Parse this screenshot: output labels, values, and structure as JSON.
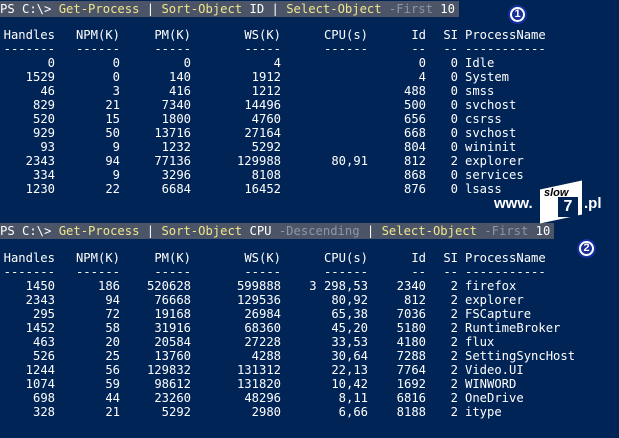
{
  "prompt": "PS C:\\> ",
  "commands": [
    {
      "marker": "1",
      "tokens": [
        {
          "t": "Get-Process",
          "c": "y"
        },
        {
          "t": " | ",
          "c": "w"
        },
        {
          "t": "Sort-Object",
          "c": "y"
        },
        {
          "t": " ID ",
          "c": "w"
        },
        {
          "t": "| ",
          "c": "w"
        },
        {
          "t": "Select-Object",
          "c": "y"
        },
        {
          "t": " -First ",
          "c": "g"
        },
        {
          "t": "10",
          "c": "w"
        }
      ],
      "rows": [
        [
          "0",
          "0",
          "0",
          "4",
          "",
          "0",
          "0",
          "Idle"
        ],
        [
          "1529",
          "0",
          "140",
          "1912",
          "",
          "4",
          "0",
          "System"
        ],
        [
          "46",
          "3",
          "416",
          "1212",
          "",
          "488",
          "0",
          "smss"
        ],
        [
          "829",
          "21",
          "7340",
          "14496",
          "",
          "500",
          "0",
          "svchost"
        ],
        [
          "520",
          "15",
          "1800",
          "4760",
          "",
          "656",
          "0",
          "csrss"
        ],
        [
          "929",
          "50",
          "13716",
          "27164",
          "",
          "668",
          "0",
          "svchost"
        ],
        [
          "93",
          "9",
          "1232",
          "5292",
          "",
          "804",
          "0",
          "wininit"
        ],
        [
          "2343",
          "94",
          "77136",
          "129988",
          "80,91",
          "812",
          "2",
          "explorer"
        ],
        [
          "334",
          "9",
          "3296",
          "8108",
          "",
          "868",
          "0",
          "services"
        ],
        [
          "1230",
          "22",
          "6684",
          "16452",
          "",
          "876",
          "0",
          "lsass"
        ]
      ]
    },
    {
      "marker": "2",
      "tokens": [
        {
          "t": "Get-Process",
          "c": "y"
        },
        {
          "t": " | ",
          "c": "w"
        },
        {
          "t": "Sort-Object",
          "c": "y"
        },
        {
          "t": " CPU ",
          "c": "w"
        },
        {
          "t": "-Descending",
          "c": "g"
        },
        {
          "t": " | ",
          "c": "w"
        },
        {
          "t": "Select-Object",
          "c": "y"
        },
        {
          "t": " -First ",
          "c": "g"
        },
        {
          "t": "10",
          "c": "w"
        }
      ],
      "rows": [
        [
          "1450",
          "186",
          "520628",
          "599888",
          "3 298,53",
          "2340",
          "2",
          "firefox"
        ],
        [
          "2343",
          "94",
          "76668",
          "129536",
          "80,92",
          "812",
          "2",
          "explorer"
        ],
        [
          "295",
          "72",
          "19168",
          "26984",
          "65,38",
          "7036",
          "2",
          "FSCapture"
        ],
        [
          "1452",
          "58",
          "31916",
          "68360",
          "45,20",
          "5180",
          "2",
          "RuntimeBroker"
        ],
        [
          "463",
          "20",
          "20584",
          "27228",
          "33,53",
          "4180",
          "2",
          "flux"
        ],
        [
          "526",
          "25",
          "13760",
          "4288",
          "30,64",
          "7288",
          "2",
          "SettingSyncHost"
        ],
        [
          "1244",
          "56",
          "129832",
          "131312",
          "22,13",
          "7764",
          "2",
          "Video.UI"
        ],
        [
          "1074",
          "59",
          "98612",
          "131820",
          "10,42",
          "1692",
          "2",
          "WINWORD"
        ],
        [
          "698",
          "44",
          "23260",
          "48296",
          "8,11",
          "6816",
          "2",
          "OneDrive"
        ],
        [
          "328",
          "21",
          "5292",
          "2980",
          "6,66",
          "8188",
          "2",
          "itype"
        ]
      ]
    }
  ],
  "headers": [
    "Handles",
    "NPM(K)",
    "PM(K)",
    "WS(K)",
    "CPU(s)",
    "Id",
    "SI",
    "ProcessName"
  ],
  "dashes": [
    "-------",
    "------",
    "-----",
    "-----",
    "------",
    "--",
    "--",
    "-----------"
  ],
  "watermark": {
    "prefix": "www.",
    "slow": "slow",
    "seven": "7",
    "suffix": ".pl"
  },
  "colors": {
    "background": "#012456",
    "command_bg": "#4b5567",
    "cmdlet": "#f0e68c",
    "parameter": "#8c96a6",
    "text": "#ffffff"
  }
}
